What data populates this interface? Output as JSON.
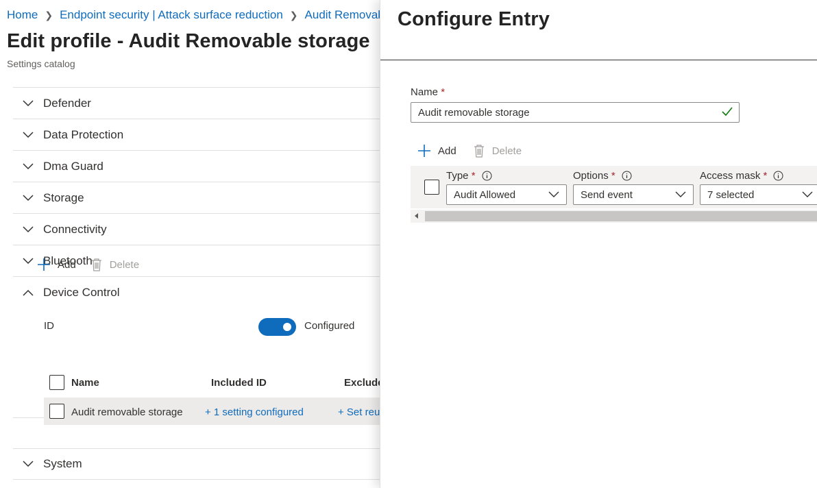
{
  "breadcrumb": {
    "items": [
      "Home",
      "Endpoint security | Attack surface reduction",
      "Audit Removable storage"
    ]
  },
  "page": {
    "title": "Edit profile - Audit Removable storage",
    "subtitle": "Settings catalog"
  },
  "sections": {
    "defender": "Defender",
    "data_protection": "Data Protection",
    "dma_guard": "Dma Guard",
    "storage": "Storage",
    "connectivity": "Connectivity",
    "bluetooth": "Bluetooth",
    "device_control": "Device Control",
    "system": "System"
  },
  "device_control": {
    "id_label": "ID",
    "toggle_state": "Configured",
    "toggle_on": true,
    "toolbar": {
      "add": "Add",
      "delete": "Delete"
    },
    "columns": {
      "name": "Name",
      "included_id": "Included ID",
      "excluded_id": "Excluded ID"
    },
    "rows": [
      {
        "name": "Audit removable storage",
        "included_id": "+ 1 setting configured",
        "excluded_id": "+ Set reusable settings"
      }
    ]
  },
  "panel": {
    "title": "Configure Entry",
    "name_label": "Name",
    "required_mark": "*",
    "name_value": "Audit removable storage",
    "toolbar": {
      "add": "Add",
      "delete": "Delete"
    },
    "columns": {
      "type": {
        "label": "Type",
        "value": "Audit Allowed"
      },
      "options": {
        "label": "Options",
        "value": "Send event"
      },
      "access_mask": {
        "label": "Access mask",
        "value": "7 selected"
      }
    }
  },
  "icons": {
    "chevron": "chevron-down-icon",
    "chevron_up": "chevron-up-icon",
    "add": "plus-icon",
    "delete": "trash-icon",
    "info": "info-icon",
    "valid": "checkmark-icon"
  },
  "colors": {
    "accent": "#0f6cbd",
    "required": "#a4262c",
    "valid": "#107c10",
    "row_highlight": "#edebe9"
  }
}
